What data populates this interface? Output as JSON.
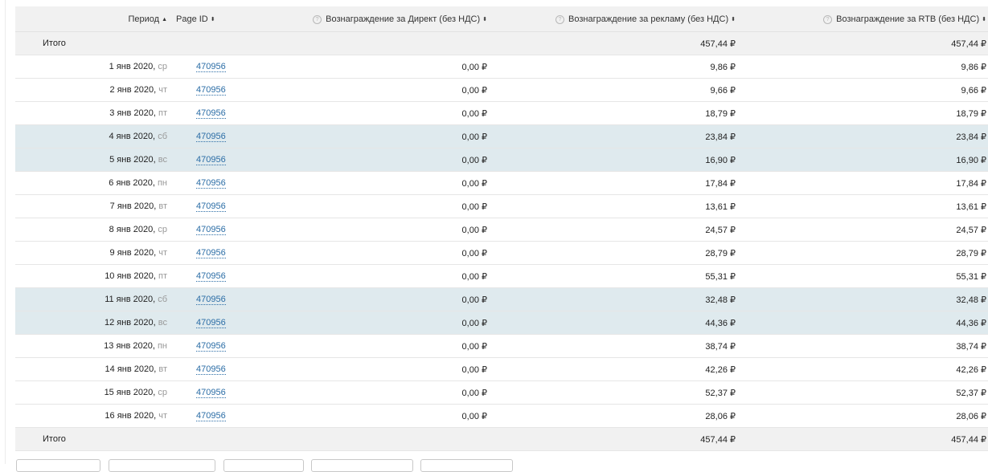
{
  "headers": {
    "period": "Период",
    "page_id": "Page ID",
    "direct": "Вознаграждение за Директ (без НДС)",
    "ad": "Вознаграждение за рекламу (без НДС)",
    "rtb": "Вознаграждение за RTB (без НДС)"
  },
  "icons": {
    "sort_asc": "▲",
    "sort": "⬍",
    "help": "?"
  },
  "total_top": {
    "label": "Итого",
    "ad": "457,44 ₽",
    "rtb": "457,44 ₽"
  },
  "rows": [
    {
      "date": "1 янв 2020,",
      "dow": "ср",
      "page_id": "470956",
      "direct": "0,00 ₽",
      "ad": "9,86 ₽",
      "rtb": "9,86 ₽"
    },
    {
      "date": "2 янв 2020,",
      "dow": "чт",
      "page_id": "470956",
      "direct": "0,00 ₽",
      "ad": "9,66 ₽",
      "rtb": "9,66 ₽"
    },
    {
      "date": "3 янв 2020,",
      "dow": "пт",
      "page_id": "470956",
      "direct": "0,00 ₽",
      "ad": "18,79 ₽",
      "rtb": "18,79 ₽"
    },
    {
      "date": "4 янв 2020,",
      "dow": "сб",
      "page_id": "470956",
      "direct": "0,00 ₽",
      "ad": "23,84 ₽",
      "rtb": "23,84 ₽"
    },
    {
      "date": "5 янв 2020,",
      "dow": "вс",
      "page_id": "470956",
      "direct": "0,00 ₽",
      "ad": "16,90 ₽",
      "rtb": "16,90 ₽"
    },
    {
      "date": "6 янв 2020,",
      "dow": "пн",
      "page_id": "470956",
      "direct": "0,00 ₽",
      "ad": "17,84 ₽",
      "rtb": "17,84 ₽"
    },
    {
      "date": "7 янв 2020,",
      "dow": "вт",
      "page_id": "470956",
      "direct": "0,00 ₽",
      "ad": "13,61 ₽",
      "rtb": "13,61 ₽"
    },
    {
      "date": "8 янв 2020,",
      "dow": "ср",
      "page_id": "470956",
      "direct": "0,00 ₽",
      "ad": "24,57 ₽",
      "rtb": "24,57 ₽"
    },
    {
      "date": "9 янв 2020,",
      "dow": "чт",
      "page_id": "470956",
      "direct": "0,00 ₽",
      "ad": "28,79 ₽",
      "rtb": "28,79 ₽"
    },
    {
      "date": "10 янв 2020,",
      "dow": "пт",
      "page_id": "470956",
      "direct": "0,00 ₽",
      "ad": "55,31 ₽",
      "rtb": "55,31 ₽"
    },
    {
      "date": "11 янв 2020,",
      "dow": "сб",
      "page_id": "470956",
      "direct": "0,00 ₽",
      "ad": "32,48 ₽",
      "rtb": "32,48 ₽"
    },
    {
      "date": "12 янв 2020,",
      "dow": "вс",
      "page_id": "470956",
      "direct": "0,00 ₽",
      "ad": "44,36 ₽",
      "rtb": "44,36 ₽"
    },
    {
      "date": "13 янв 2020,",
      "dow": "пн",
      "page_id": "470956",
      "direct": "0,00 ₽",
      "ad": "38,74 ₽",
      "rtb": "38,74 ₽"
    },
    {
      "date": "14 янв 2020,",
      "dow": "вт",
      "page_id": "470956",
      "direct": "0,00 ₽",
      "ad": "42,26 ₽",
      "rtb": "42,26 ₽"
    },
    {
      "date": "15 янв 2020,",
      "dow": "ср",
      "page_id": "470956",
      "direct": "0,00 ₽",
      "ad": "52,37 ₽",
      "rtb": "52,37 ₽"
    },
    {
      "date": "16 янв 2020,",
      "dow": "чт",
      "page_id": "470956",
      "direct": "0,00 ₽",
      "ad": "28,06 ₽",
      "rtb": "28,06 ₽"
    }
  ],
  "total_bottom": {
    "label": "Итого",
    "ad": "457,44 ₽",
    "rtb": "457,44 ₽"
  },
  "colors": {
    "weekend_row": "#dfeaee",
    "total_row": "#f1f1f1",
    "link": "#2b6da6"
  }
}
